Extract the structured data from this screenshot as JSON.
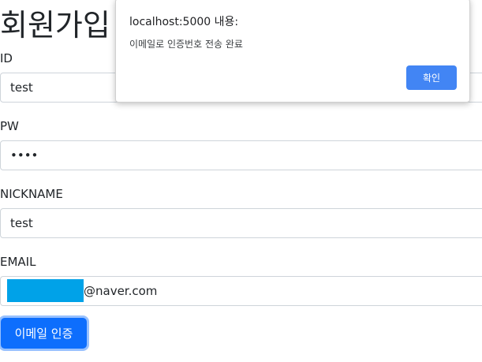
{
  "page": {
    "title": "회원가입"
  },
  "form": {
    "id_label": "ID",
    "id_value": "test",
    "pw_label": "PW",
    "pw_value": "test",
    "nickname_label": "NICKNAME",
    "nickname_value": "test",
    "email_label": "EMAIL",
    "email_domain": "@naver.com",
    "verify_button_label": "이메일 인증"
  },
  "dialog": {
    "origin": "localhost:5000 내용:",
    "message": "이메일로 인증번호 전송 완료",
    "ok_label": "확인"
  },
  "colors": {
    "primary": "#0d6efd",
    "dialog_button": "#4285f4",
    "redaction": "#00a2e8"
  }
}
